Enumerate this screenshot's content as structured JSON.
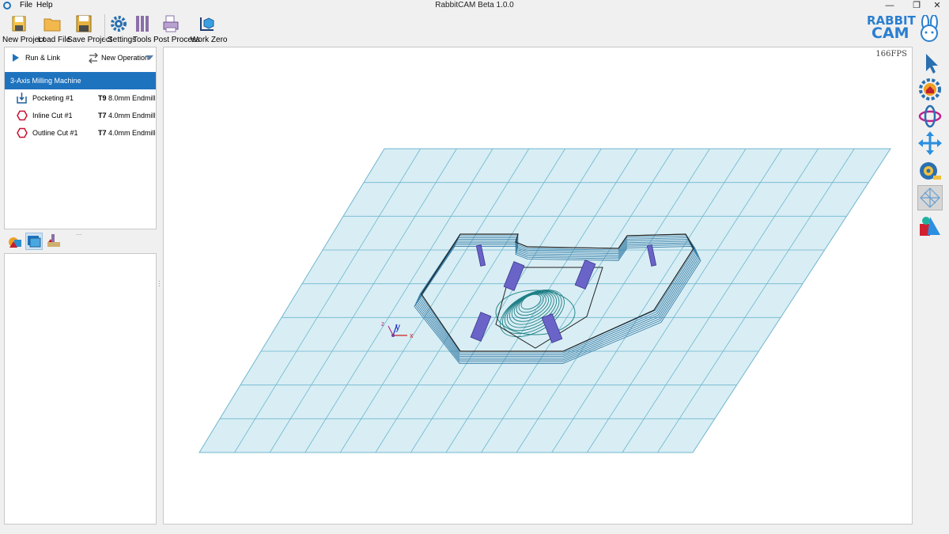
{
  "window": {
    "title": "RabbitCAM Beta 1.0.0",
    "menu": [
      "File",
      "Help"
    ]
  },
  "toolbar": {
    "new_project": "New Project",
    "load_file": "Load File",
    "save_project": "Save Project",
    "settings": "Settings",
    "tools": "Tools",
    "post_process": "Post Process",
    "work_zero": "Work Zero"
  },
  "logo": {
    "line1": "RABBIT",
    "line2": "CAM"
  },
  "operations": {
    "run_link": "Run & Link",
    "new_operation": "New Operation",
    "machine": "3-Axis Milling Machine",
    "items": [
      {
        "name": "Pocketing #1",
        "tool_id": "T9",
        "tool_desc": "8.0mm Endmill"
      },
      {
        "name": "Inline Cut #1",
        "tool_id": "T7",
        "tool_desc": "4.0mm Endmill"
      },
      {
        "name": "Outline Cut #1",
        "tool_id": "T7",
        "tool_desc": "4.0mm Endmill"
      }
    ]
  },
  "viewport": {
    "fps": "166FPS",
    "axis": {
      "x": "x",
      "y": "y",
      "z": "z"
    }
  },
  "colors": {
    "selection": "#1e73be",
    "grid_fill": "#d8eef4",
    "grid_line": "#6fb5cf",
    "toolpath": "#3a7fa8"
  }
}
